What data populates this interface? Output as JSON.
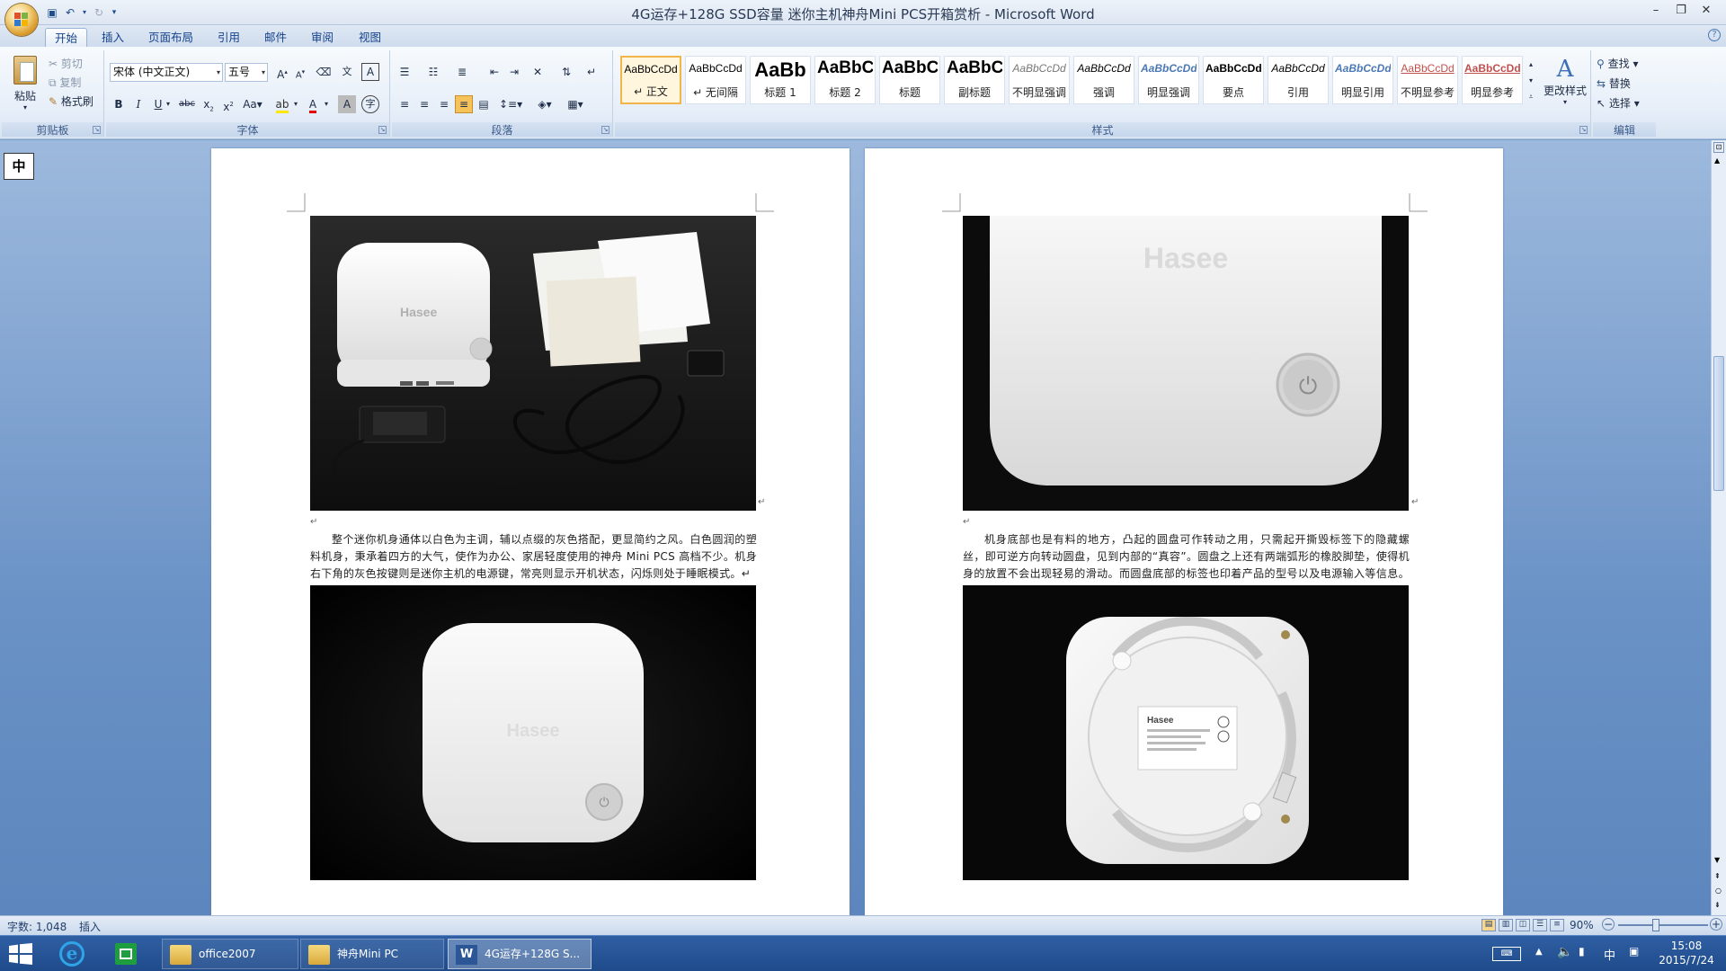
{
  "window": {
    "title": "4G运存+128G SSD容量 迷你主机神舟Mini PCS开箱赏析 - Microsoft Word"
  },
  "ribbon": {
    "tabs": [
      "开始",
      "插入",
      "页面布局",
      "引用",
      "邮件",
      "审阅",
      "视图"
    ],
    "active_tab": "开始",
    "clipboard": {
      "label": "剪贴板",
      "paste": "粘贴",
      "cut": "剪切",
      "copy": "复制",
      "format_painter": "格式刷"
    },
    "font": {
      "label": "字体",
      "font_name": "宋体 (中文正文)",
      "font_size": "五号"
    },
    "paragraph": {
      "label": "段落"
    },
    "styles": {
      "label": "样式",
      "change_styles": "更改样式",
      "items": [
        {
          "preview": "AaBbCcDd",
          "name": "↵ 正文",
          "selected": true
        },
        {
          "preview": "AaBbCcDd",
          "name": "↵ 无间隔"
        },
        {
          "preview": "AaBb",
          "name": "标题 1"
        },
        {
          "preview": "AaBbC",
          "name": "标题 2"
        },
        {
          "preview": "AaBbC",
          "name": "标题"
        },
        {
          "preview": "AaBbC",
          "name": "副标题"
        },
        {
          "preview": "AaBbCcDd",
          "name": "不明显强调"
        },
        {
          "preview": "AaBbCcDd",
          "name": "强调"
        },
        {
          "preview": "AaBbCcDd",
          "name": "明显强调"
        },
        {
          "preview": "AaBbCcDd",
          "name": "要点"
        },
        {
          "preview": "AaBbCcDd",
          "name": "引用"
        },
        {
          "preview": "AaBbCcDd",
          "name": "明显引用"
        },
        {
          "preview": "AaBbCcDd",
          "name": "不明显参考"
        },
        {
          "preview": "AaBbCcDd",
          "name": "明显参考"
        }
      ]
    },
    "editing": {
      "label": "编辑",
      "find": "查找",
      "replace": "替换",
      "select": "选择"
    }
  },
  "ime": {
    "label": "中"
  },
  "document": {
    "left_paragraph": "整个迷你机身通体以白色为主调，辅以点缀的灰色搭配，更显简约之风。白色圆润的塑料机身，秉承着四方的大气，使作为办公、家居轻度使用的神舟 Mini PCS 高档不少。机身右下角的灰色按键则是迷你主机的电源键，常亮则显示开机状态，闪烁则处于睡眠模式。↵",
    "right_paragraph": "机身底部也是有料的地方，凸起的圆盘可作转动之用，只需起开撕毁标签下的隐藏螺丝，即可逆方向转动圆盘，见到内部的“真容”。圆盘之上还有两端弧形的橡胶脚垫，使得机身的放置不会出现轻易的滑动。而圆盘底部的标签也印着产品的型号以及电源输入等信息。↵",
    "brand_logo": "Hasee",
    "return_mark": "↵"
  },
  "statusbar": {
    "word_count": "字数: 1,048",
    "mode": "插入",
    "zoom": "90%"
  },
  "taskbar": {
    "items": [
      {
        "label": "office2007"
      },
      {
        "label": "神舟Mini PC"
      },
      {
        "label": "4G运存+128G S...",
        "active": true
      }
    ],
    "tray_ime": "中",
    "time": "15:08",
    "date": "2015/7/24"
  }
}
